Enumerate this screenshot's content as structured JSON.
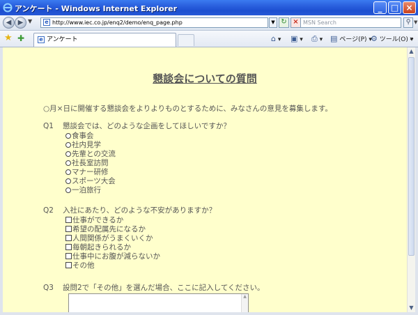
{
  "window": {
    "title": "アンケート - Windows Internet Explorer",
    "min_glyph": "_",
    "max_glyph": "□",
    "close_glyph": "×"
  },
  "address": {
    "url": "http://www.iec.co.jp/enq2/demo/enq_page.php",
    "search_placeholder": "MSN Search"
  },
  "tabbar": {
    "tab_label": "アンケート",
    "page_menu": "ページ(P)",
    "tools_menu": "ツール(O)",
    "more": "»"
  },
  "page": {
    "title": "懇談会についての質問",
    "intro": "○月×日に開催する懇談会をよりよりものとするために、みなさんの意見を募集します。",
    "q1": {
      "num": "Q1",
      "text": "懇談会では、どのような企画をしてほしいですか？",
      "options": [
        "食事会",
        "社内見学",
        "先輩との交流",
        "社長室訪問",
        "マナー研修",
        "スポーツ大会",
        "一泊旅行"
      ]
    },
    "q2": {
      "num": "Q2",
      "text": "入社にあたり、どのような不安がありますか？",
      "options": [
        "仕事ができるか",
        "希望の配属先になるか",
        "人間関係がうまくいくか",
        "毎朝起きられるか",
        "仕事中にお腹が減らないか",
        "その他"
      ]
    },
    "q3": {
      "num": "Q3",
      "text": "設問2で「その他」を選んだ場合、ここに記入してください。",
      "answer": ""
    }
  }
}
